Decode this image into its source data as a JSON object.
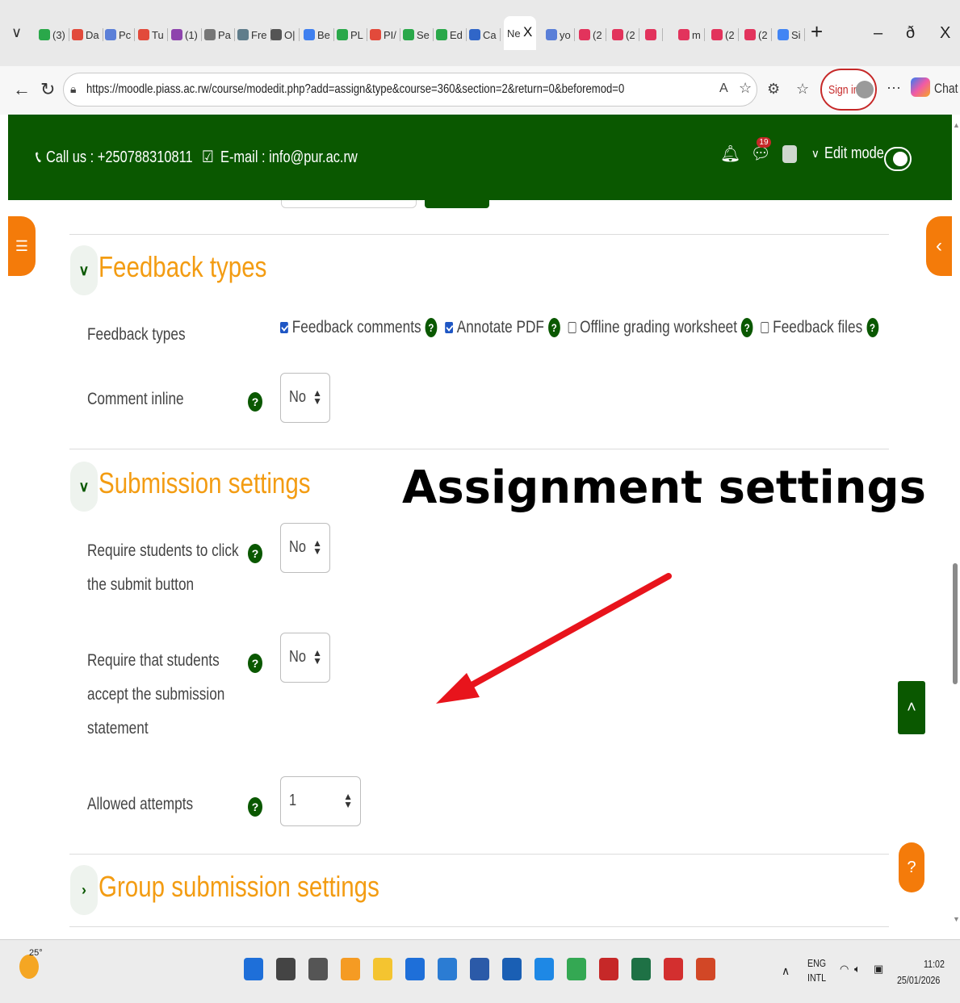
{
  "browser": {
    "active_tab_label": "Ne",
    "tabs": [
      {
        "label": "(3)",
        "color": "#2aa84a"
      },
      {
        "label": "Da",
        "color": "#e24a3b"
      },
      {
        "label": "Pc",
        "color": "#5b7fd8"
      },
      {
        "label": "Tu",
        "color": "#e24a3b"
      },
      {
        "label": "(1)",
        "color": "#8e44ad"
      },
      {
        "label": "Pa",
        "color": "#777777"
      },
      {
        "label": "Fre",
        "color": "#607d8b"
      },
      {
        "label": "O|",
        "color": "#555555"
      },
      {
        "label": "Be",
        "color": "#3f80f0"
      },
      {
        "label": "PL",
        "color": "#2aa84a"
      },
      {
        "label": "PI/",
        "color": "#e24a3b"
      },
      {
        "label": "Se",
        "color": "#2aa84a"
      },
      {
        "label": "Ed",
        "color": "#2aa84a"
      },
      {
        "label": "Ca",
        "color": "#3066c8"
      }
    ],
    "tabs_after": [
      {
        "label": "yo",
        "color": "#5a7fd8"
      },
      {
        "label": "(2",
        "color": "#e2335c"
      },
      {
        "label": "(2",
        "color": "#e2335c"
      },
      {
        "label": "",
        "color": "#e2335c"
      },
      {
        "label": "m",
        "color": "#e2335c"
      },
      {
        "label": "(2",
        "color": "#e2335c"
      },
      {
        "label": "(2",
        "color": "#e2335c"
      },
      {
        "label": "Si",
        "color": "#4285f4"
      }
    ],
    "url": "https://moodle.piass.ac.rw/course/modedit.php?add=assign&type&course=360&section=2&return=0&beforemod=0",
    "sign_in_label": "Sign in",
    "chat_label": "Chat",
    "close_tab": "X",
    "new_tab": "+",
    "minimize": "–",
    "restore": "ð",
    "close_window": "X"
  },
  "header": {
    "call": "Call us : +250788310811",
    "email": "E-mail : info@pur.ac.rw",
    "notification_count": "19",
    "edit_mode_label": "Edit mode"
  },
  "feedback": {
    "title": "Feedback types",
    "types_label": "Feedback types",
    "options": [
      {
        "label": "Feedback comments",
        "checked": true
      },
      {
        "label": "Annotate PDF",
        "checked": true
      },
      {
        "label": "Offline grading worksheet",
        "checked": false
      },
      {
        "label": "Feedback files",
        "checked": false
      }
    ],
    "comment_inline_label": "Comment inline",
    "comment_inline_value": "No"
  },
  "submission": {
    "title": "Submission settings",
    "require_submit_label_1": "Require students to click",
    "require_submit_label_2": "the submit button",
    "require_submit_value": "No",
    "accept_statement_label_1": "Require that students",
    "accept_statement_label_2": "accept the submission",
    "accept_statement_label_3": "statement",
    "accept_statement_value": "No",
    "attempts_label": "Allowed attempts",
    "attempts_value": "1"
  },
  "group": {
    "title": "Group submission settings"
  },
  "overlay_title": "Assignment settings",
  "taskbar": {
    "weather": "25°",
    "lang_1": "ENG",
    "lang_2": "INTL",
    "time": "11:02",
    "date": "25/01/2026"
  }
}
